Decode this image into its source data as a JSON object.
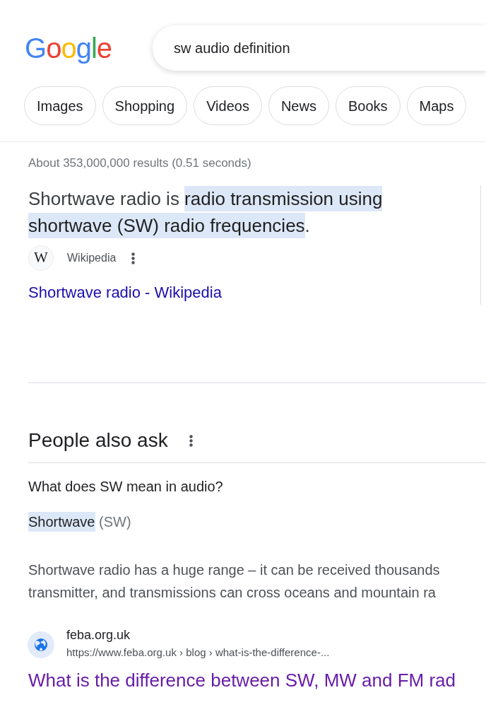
{
  "header": {
    "logo": "Google",
    "search": {
      "value": "sw audio definition"
    }
  },
  "chips": [
    "Images",
    "Shopping",
    "Videos",
    "News",
    "Books",
    "Maps"
  ],
  "results_count": "About 353,000,000 results (0.51 seconds)",
  "featured_snippet": {
    "parts": [
      {
        "text": "Shortwave radio is ",
        "highlighted": false
      },
      {
        "text": "radio transmission using shortwave (SW) radio frequencies",
        "highlighted": true
      },
      {
        "text": ".",
        "highlighted": false
      }
    ],
    "source": {
      "icon_letter": "W",
      "name": "Wikipedia"
    },
    "link": "Shortwave radio - Wikipedia"
  },
  "people_also_ask": {
    "title": "People also ask",
    "question": "What does SW mean in audio?",
    "answer": [
      {
        "text": "Shortwave",
        "highlighted": true
      },
      {
        "text": " (SW)",
        "highlighted": false
      }
    ],
    "snippet_lines": [
      "Shortwave radio has a huge range – it can be received thousands",
      "transmitter, and transmissions can cross oceans and mountain ra"
    ],
    "source": {
      "site": "feba.org.uk",
      "url": "https://www.feba.org.uk › blog › what-is-the-difference-..."
    },
    "link": "What is the difference between SW, MW and FM rad"
  }
}
